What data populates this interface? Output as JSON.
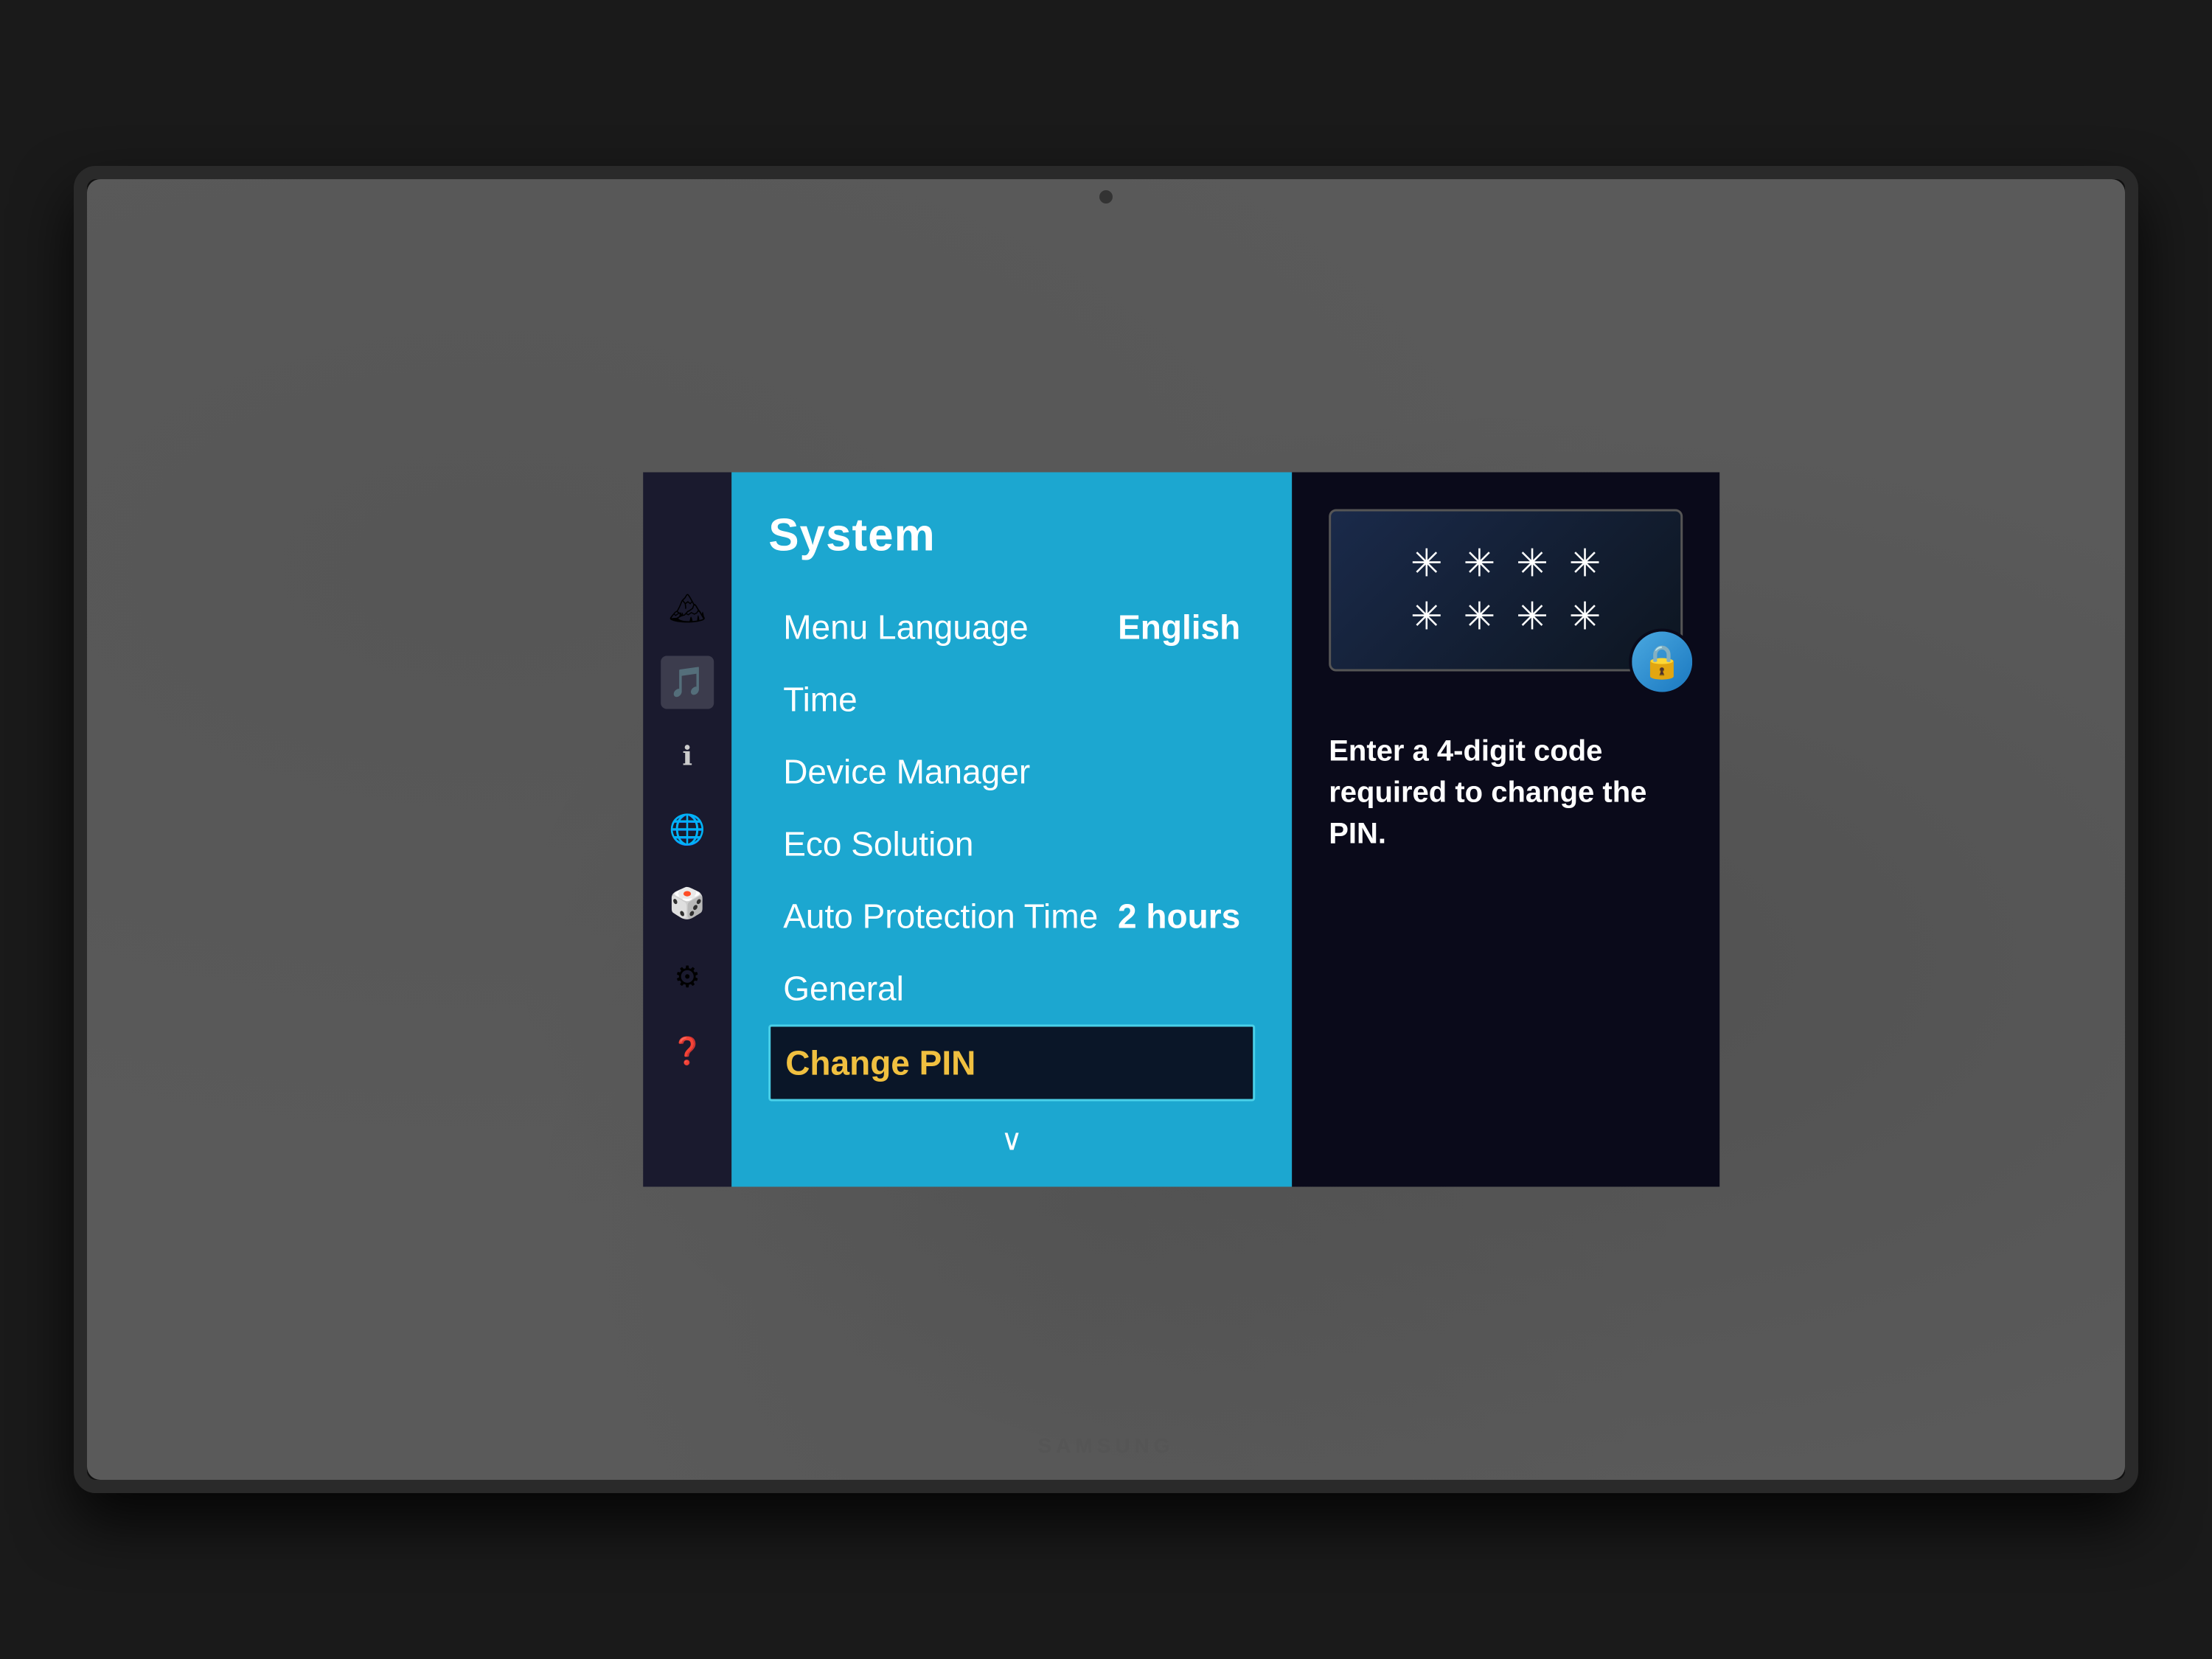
{
  "tv": {
    "brand": "SAMSUNG",
    "camera_visible": true
  },
  "menu": {
    "title": "System",
    "items": [
      {
        "id": "menu-language",
        "label": "Menu Language",
        "value": "English",
        "selected": false
      },
      {
        "id": "time",
        "label": "Time",
        "value": "",
        "selected": false
      },
      {
        "id": "device-manager",
        "label": "Device Manager",
        "value": "",
        "selected": false
      },
      {
        "id": "eco-solution",
        "label": "Eco Solution",
        "value": "",
        "selected": false
      },
      {
        "id": "auto-protection-time",
        "label": "Auto Protection Time",
        "value": "2 hours",
        "selected": false
      },
      {
        "id": "general",
        "label": "General",
        "value": "",
        "selected": false
      },
      {
        "id": "change-pin",
        "label": "Change PIN",
        "value": "",
        "selected": true
      }
    ],
    "scroll_indicator": "∨"
  },
  "sidebar": {
    "icons": [
      {
        "id": "photos",
        "symbol": "🏔",
        "active": false
      },
      {
        "id": "audio",
        "symbol": "🎵",
        "active": true
      },
      {
        "id": "info",
        "symbol": "ℹ",
        "active": false
      },
      {
        "id": "web",
        "symbol": "🌐",
        "active": false
      },
      {
        "id": "apps",
        "symbol": "🎮",
        "active": false
      },
      {
        "id": "settings",
        "symbol": "⚙",
        "active": false
      },
      {
        "id": "help",
        "symbol": "❓",
        "active": false
      }
    ]
  },
  "info_panel": {
    "pin_dots_row1": [
      "✳",
      "✳",
      "✳",
      "✳"
    ],
    "pin_dots_row2": [
      "✳",
      "✳",
      "✳",
      "✳"
    ],
    "lock_icon": "🔒",
    "description": "Enter a 4-digit code required to change the PIN."
  },
  "colors": {
    "menu_bg": "#1ca7d0",
    "menu_selected_bg": "#0a1628",
    "menu_selected_border": "#4ad0e8",
    "menu_selected_text": "#f0c040",
    "info_panel_bg": "#0a0a1a",
    "sidebar_bg": "#1a1a2e",
    "lock_badge_bg": "#2288cc"
  }
}
